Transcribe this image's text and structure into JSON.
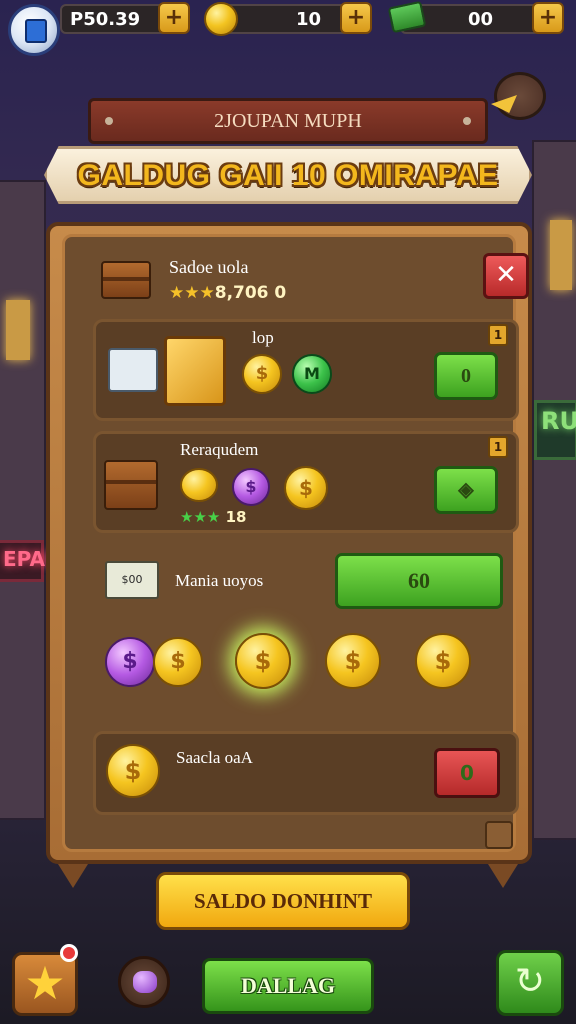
{
  "topbar": {
    "currency1": {
      "value": "P50.39",
      "plus": "+"
    },
    "currency2": {
      "value": "10",
      "plus": "+"
    },
    "currency3": {
      "value": "00",
      "plus": "+"
    }
  },
  "header": {
    "board_title": "2JOUPAN MUPH",
    "ribbon_title": "GALDUG GAII 10 OMIRAPAE"
  },
  "panel": {
    "title": "Sadoe uola",
    "stars": "★★★",
    "stars_value": "8,706 0",
    "close_label": "✕",
    "row1": {
      "title": "lop",
      "badge": "1",
      "coin_green": "M",
      "coin_gold": "$",
      "button": "0"
    },
    "row2": {
      "title": "Reraqudem",
      "badge": "1",
      "stars": "★★★",
      "stars_value": "18",
      "button": "◈"
    },
    "row3": {
      "bills_label": "$00",
      "title": "Mania uoyos",
      "button": "60",
      "coins": [
        "$",
        "$",
        "$",
        "$",
        "$"
      ]
    },
    "row4": {
      "title": "Saacla oaA",
      "coin": "$",
      "button": "0"
    }
  },
  "bottom": {
    "primary_button": "SALDO DONHINT",
    "nav_button": "DALLAG",
    "star_icon": "★",
    "refresh_icon": "↻"
  },
  "background": {
    "sign_right": "RUZ",
    "sign_left": "EPAE"
  },
  "colors": {
    "gold": "#f5c520",
    "green_button": "#3da220",
    "red_button": "#b52a2a",
    "panel_wood": "#a86d35"
  }
}
